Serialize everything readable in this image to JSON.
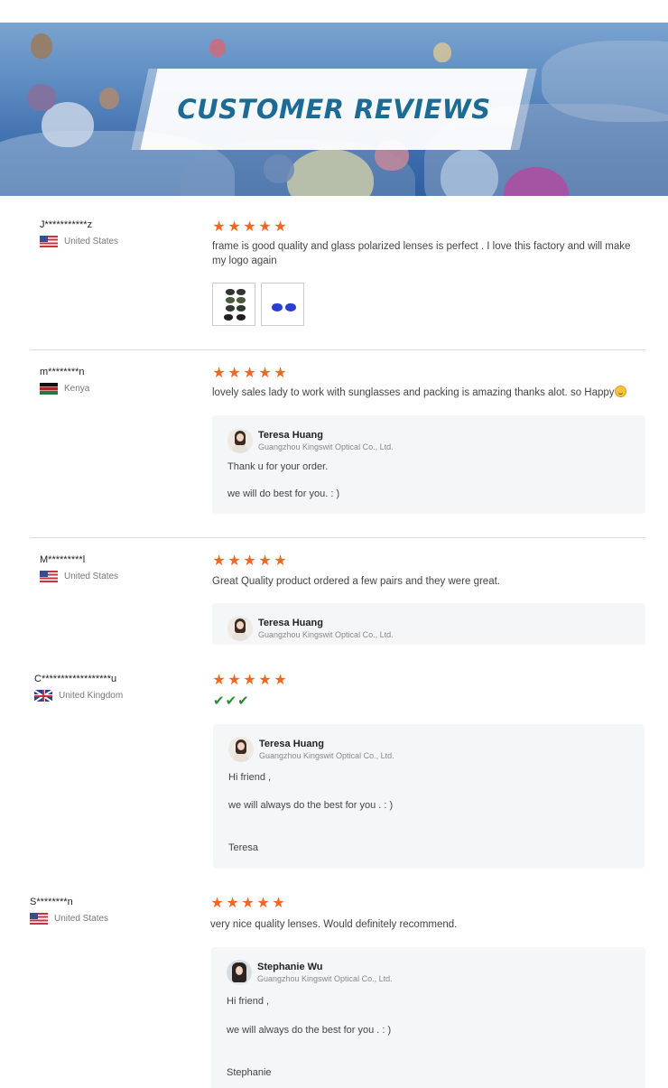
{
  "banner": {
    "title": "CUSTOMER REVIEWS"
  },
  "reviews": [
    {
      "reviewer": "J***********z",
      "country": "United States",
      "flag": "us-flag",
      "rating": 5,
      "comment": "frame is good quality and glass polarized lenses is perfect . I love this factory and will make my logo again",
      "images": [
        "sunglasses-photo",
        "sunglasses-photo"
      ]
    },
    {
      "reviewer": "m********n",
      "country": "Kenya",
      "flag": "kenya-flag",
      "rating": 5,
      "comment": "lovely sales lady to work with sunglasses and packing is amazing thanks alot. so Happy",
      "emoji": "smiling-face-icon",
      "reply": {
        "name": "Teresa Huang",
        "company": "Guangzhou Kingswit Optical Co., Ltd.",
        "lines": [
          "Thank u for your order.",
          "we will do best for you. : )"
        ]
      }
    },
    {
      "reviewer": "M*********l",
      "country": "United States",
      "flag": "us-flag",
      "rating": 5,
      "comment": "Great Quality product ordered a few pairs and they were great.",
      "reply": {
        "name": "Teresa Huang",
        "company": "Guangzhou Kingswit Optical Co., Ltd."
      }
    },
    {
      "reviewer": "C******************u",
      "country": "United Kingdom",
      "flag": "uk-flag",
      "rating": 5,
      "checks": 3,
      "reply": {
        "name": "Teresa Huang",
        "company": "Guangzhou Kingswit Optical Co., Ltd.",
        "lines": [
          "Hi friend ,",
          "we will always do the best for you .  : )",
          "Teresa"
        ]
      }
    },
    {
      "reviewer": "S********n",
      "country": "United States",
      "flag": "us-flag",
      "rating": 5,
      "comment": "very nice quality lenses. Would definitely recommend.",
      "reply": {
        "name": "Stephanie Wu",
        "company": "Guangzhou Kingswit Optical Co., Ltd.",
        "lines": [
          "Hi friend ,",
          "we will always do the best for you .  : )",
          "Stephanie"
        ]
      }
    }
  ],
  "colors": {
    "star": "#f26722",
    "title": "#1d6b94",
    "check": "#2e8b2e"
  }
}
